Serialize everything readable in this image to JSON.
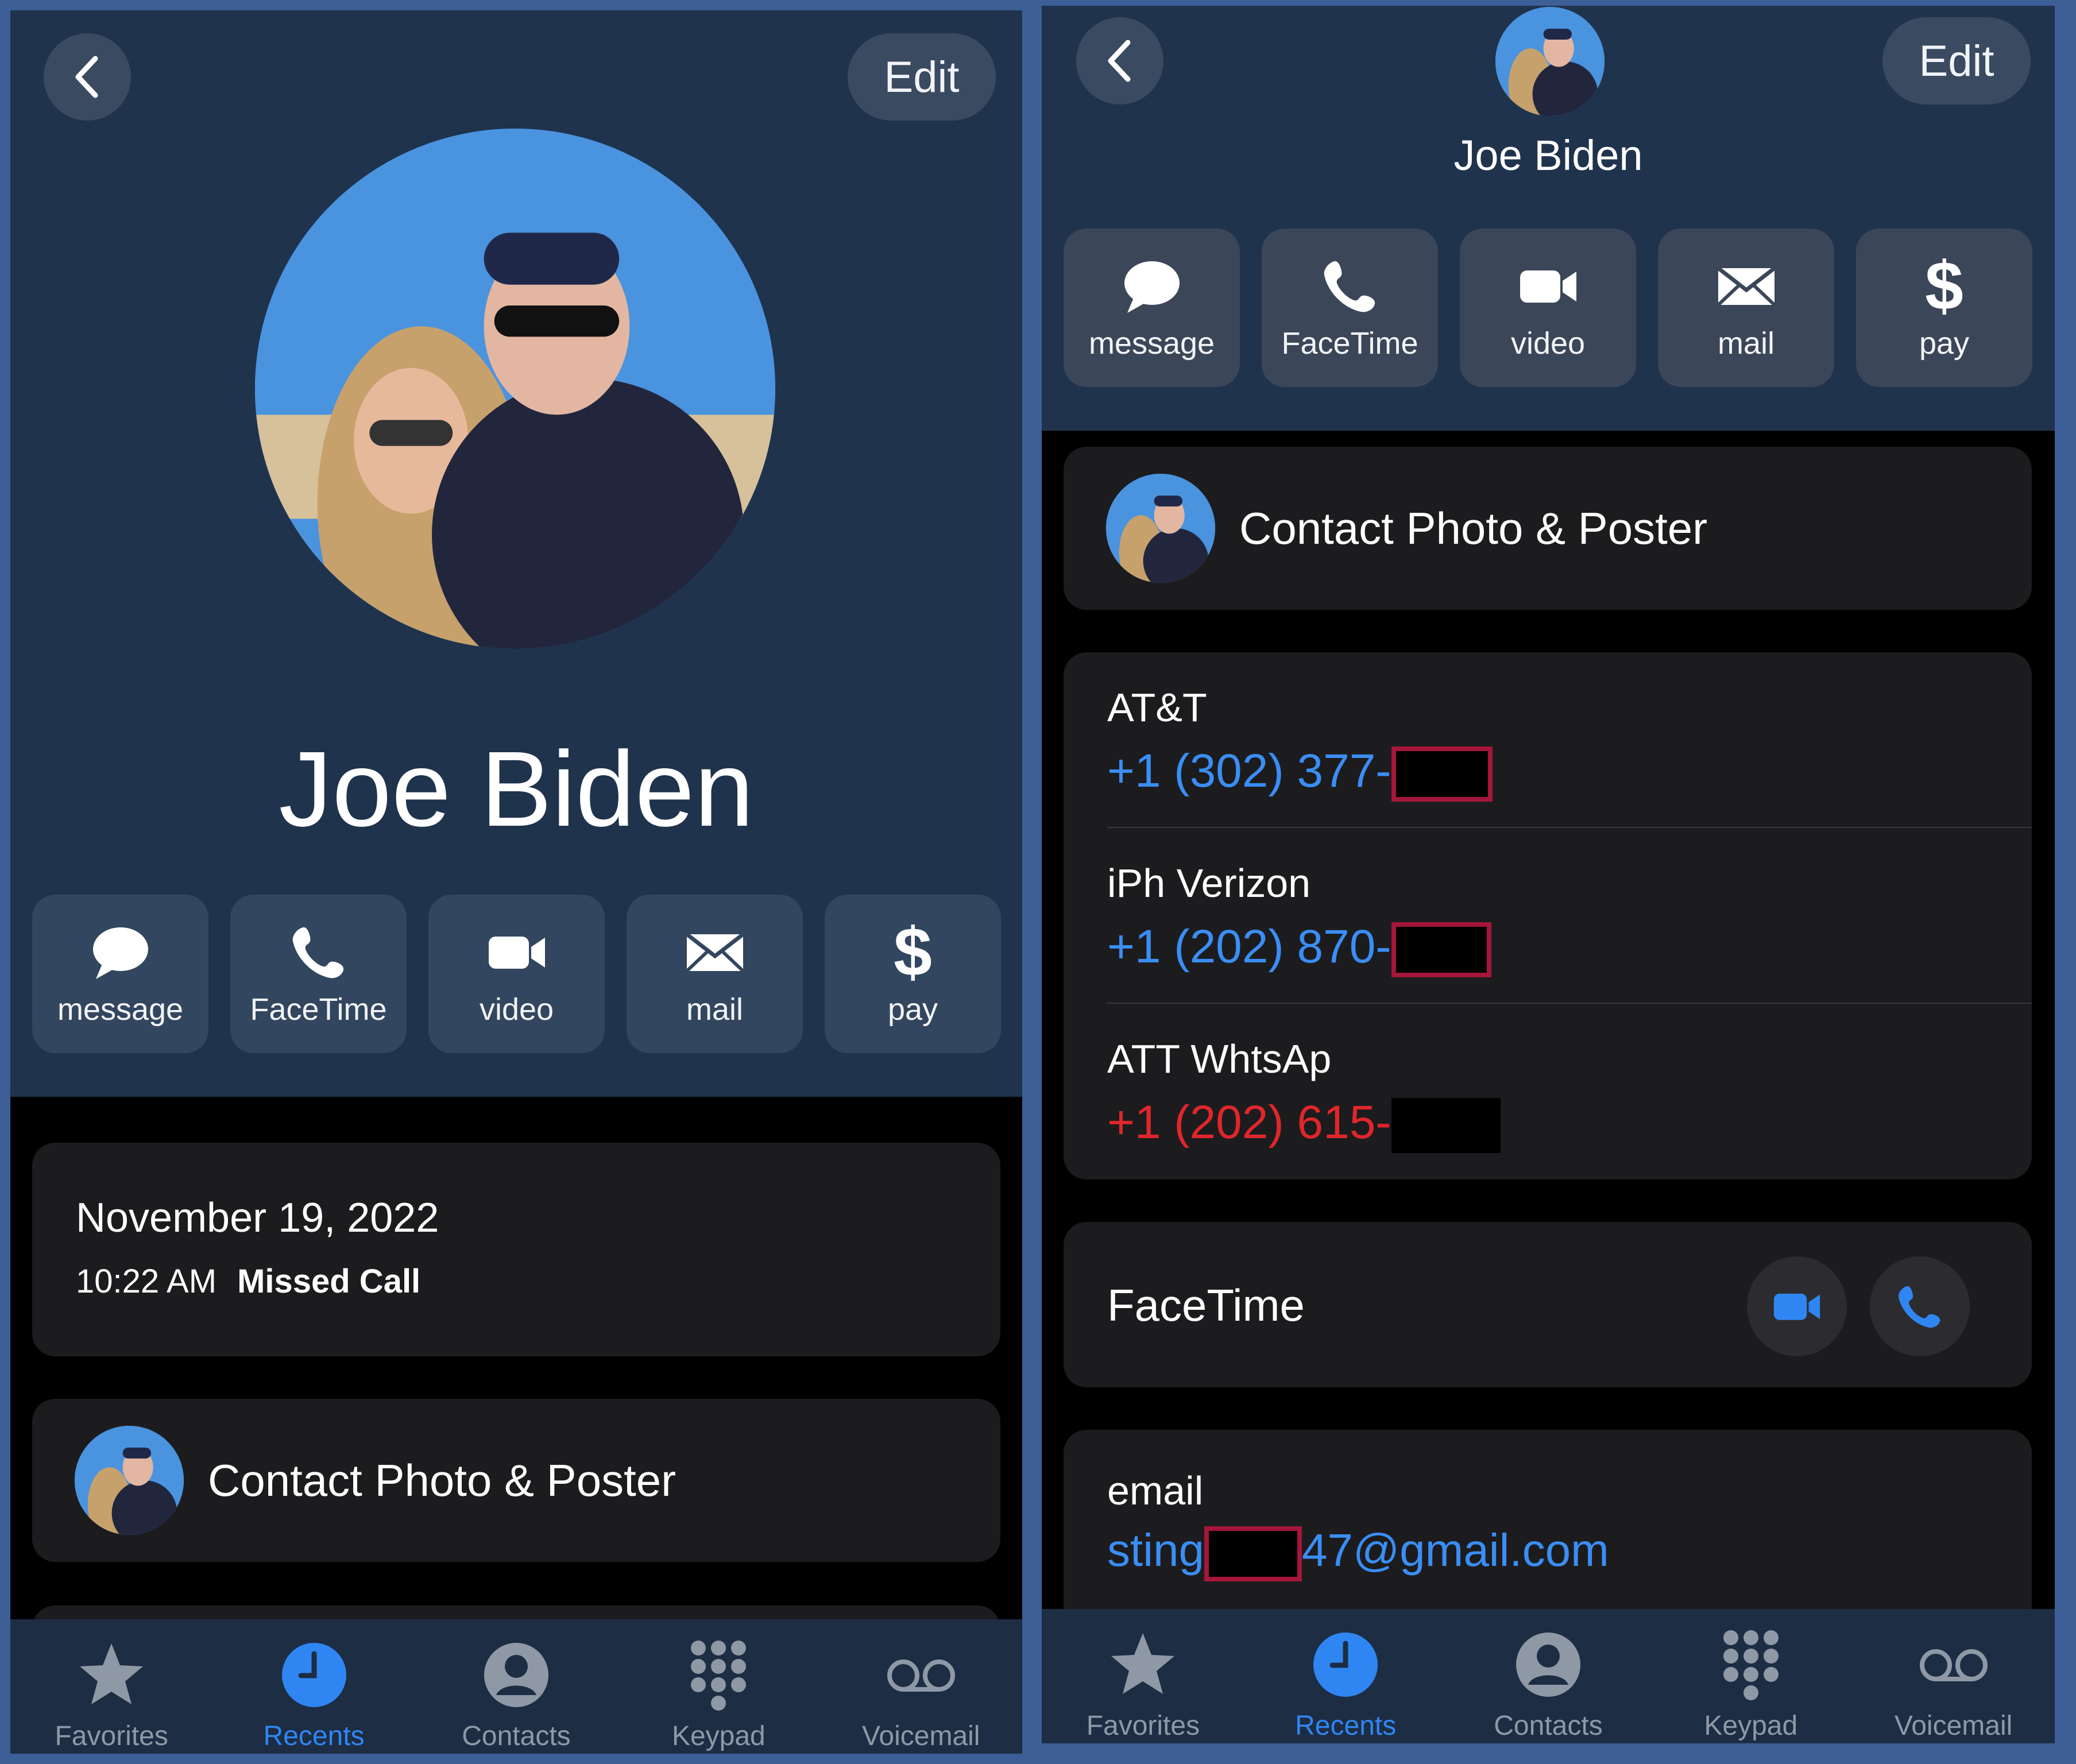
{
  "left": {
    "edit_label": "Edit",
    "contact_name": "Joe Biden",
    "actions": [
      {
        "label": "message",
        "icon": "message-icon"
      },
      {
        "label": "FaceTime",
        "icon": "phone-icon"
      },
      {
        "label": "video",
        "icon": "video-icon"
      },
      {
        "label": "mail",
        "icon": "mail-icon"
      },
      {
        "label": "pay",
        "icon": "dollar-icon",
        "glyph": "$"
      }
    ],
    "recent_call": {
      "date": "November 19, 2022",
      "time": "10:22 AM",
      "status": "Missed Call"
    },
    "poster_label": "Contact Photo & Poster"
  },
  "right": {
    "edit_label": "Edit",
    "contact_name": "Joe Biden",
    "actions": [
      {
        "label": "message",
        "icon": "message-icon"
      },
      {
        "label": "FaceTime",
        "icon": "phone-icon"
      },
      {
        "label": "video",
        "icon": "video-icon"
      },
      {
        "label": "mail",
        "icon": "mail-icon"
      },
      {
        "label": "pay",
        "icon": "dollar-icon",
        "glyph": "$"
      }
    ],
    "poster_label": "Contact Photo & Poster",
    "phones": [
      {
        "label": "AT&T",
        "number": "+1 (302) 377-",
        "color": "#3a8ef5"
      },
      {
        "label": "iPh Verizon",
        "number": "+1 (202) 870-",
        "color": "#3a8ef5"
      },
      {
        "label": "ATT WhtsAp",
        "number": "+1 (202) 615-",
        "color": "#e0262b"
      }
    ],
    "facetime_label": "FaceTime",
    "email": {
      "label": "email",
      "prefix": "sting",
      "suffix": "47@gmail.com"
    }
  },
  "tabs": [
    {
      "label": "Favorites",
      "icon": "star-icon",
      "active": false
    },
    {
      "label": "Recents",
      "icon": "clock-icon",
      "active": true
    },
    {
      "label": "Contacts",
      "icon": "person-icon",
      "active": false
    },
    {
      "label": "Keypad",
      "icon": "keypad-icon",
      "active": false
    },
    {
      "label": "Voicemail",
      "icon": "voicemail-icon",
      "active": false
    }
  ],
  "colors": {
    "accent": "#2f86f2",
    "link": "#3a8ef5",
    "alert": "#e0262b",
    "header": "#1f334d",
    "redaction_border": "#a6163a"
  }
}
